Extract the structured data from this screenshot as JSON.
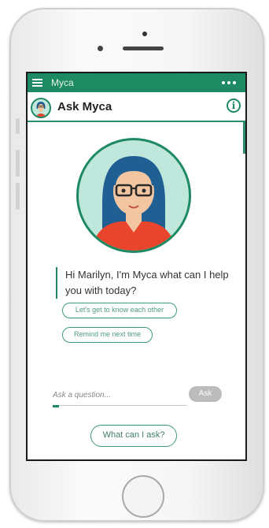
{
  "app": {
    "title": "Myca",
    "accent": "#1e8a63"
  },
  "header": {
    "title": "Ask Myca",
    "info_icon": "info-icon"
  },
  "chat": {
    "message": "Hi Marilyn, I'm Myca what can I help you with today?"
  },
  "suggestions": [
    "Let's get to know each other",
    "Remind me next time"
  ],
  "input": {
    "placeholder": "Ask a question...",
    "value": "",
    "ask_label": "Ask"
  },
  "footer": {
    "what_can_i_ask_label": "What can I ask?"
  }
}
